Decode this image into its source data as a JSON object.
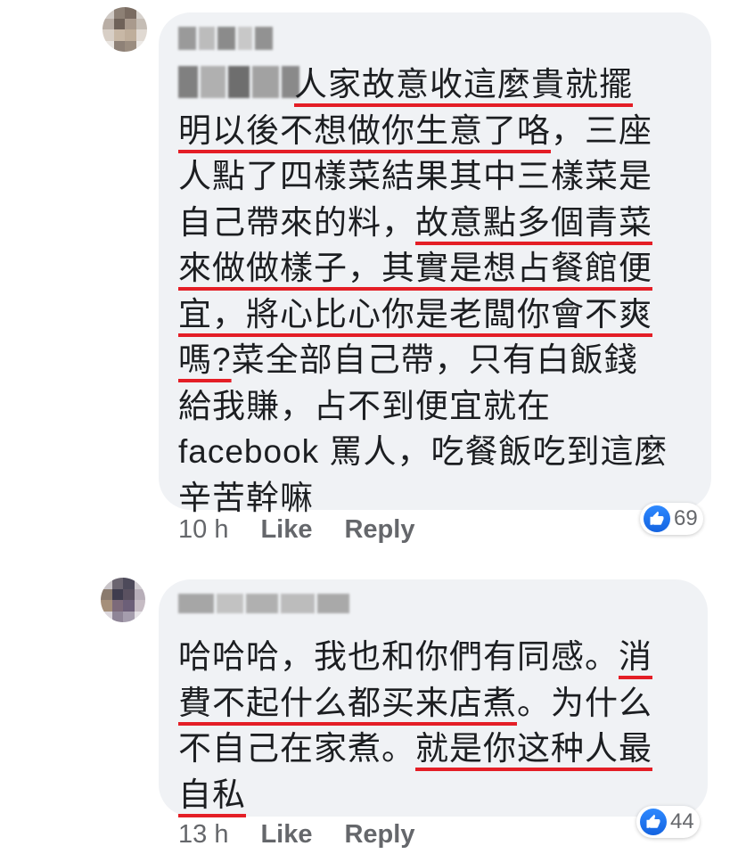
{
  "comments": [
    {
      "author_hidden": true,
      "tag_hidden": true,
      "lines": [
        [
          {
            "t": "人家故意收這麼貴就擺",
            "u": true
          }
        ],
        [
          {
            "t": "明以後不想做你生意了咯",
            "u": true
          },
          {
            "t": "，三座",
            "u": false
          }
        ],
        [
          {
            "t": "人點了四樣菜結果其中三樣菜是",
            "u": false
          }
        ],
        [
          {
            "t": "自己帶來的料，",
            "u": false
          },
          {
            "t": "故意點多個青菜",
            "u": true
          }
        ],
        [
          {
            "t": "來做做樣子",
            "u": true
          },
          {
            "t": "，其實是想占餐館便",
            "u": true
          }
        ],
        [
          {
            "t": "宜，將心比心你是老闆你會不爽",
            "u": true
          }
        ],
        [
          {
            "t": "嗎?",
            "u": true
          },
          {
            "t": "菜全部自己帶，只有白飯錢",
            "u": false
          }
        ],
        [
          {
            "t": "給我賺，占不到便宜就在",
            "u": false
          }
        ],
        [
          {
            "t": "facebook 罵人，吃餐飯吃到這麼",
            "u": false
          }
        ],
        [
          {
            "t": "辛苦幹嘛",
            "u": false
          }
        ]
      ],
      "reaction_count": "69",
      "time": "10 h",
      "like_label": "Like",
      "reply_label": "Reply"
    },
    {
      "author_hidden": true,
      "lines": [
        [
          {
            "t": "哈哈哈，我也和你們有同感。",
            "u": false
          },
          {
            "t": "消",
            "u": true
          }
        ],
        [
          {
            "t": "費不起什么都买来店煮",
            "u": true
          },
          {
            "t": "。为什么",
            "u": false
          }
        ],
        [
          {
            "t": "不自己在家煮。",
            "u": false
          },
          {
            "t": "就是你这种人最",
            "u": true
          }
        ],
        [
          {
            "t": "自私",
            "u": true
          }
        ]
      ],
      "reaction_count": "44",
      "time": "13 h",
      "like_label": "Like",
      "reply_label": "Reply"
    }
  ],
  "colors": {
    "bubble": "#f0f2f5",
    "text": "#1c1e21",
    "meta": "#65676b",
    "underline": "#e41e26",
    "like_blue": "#1877f2"
  },
  "icons": {
    "reaction": "thumbs-up-icon"
  }
}
